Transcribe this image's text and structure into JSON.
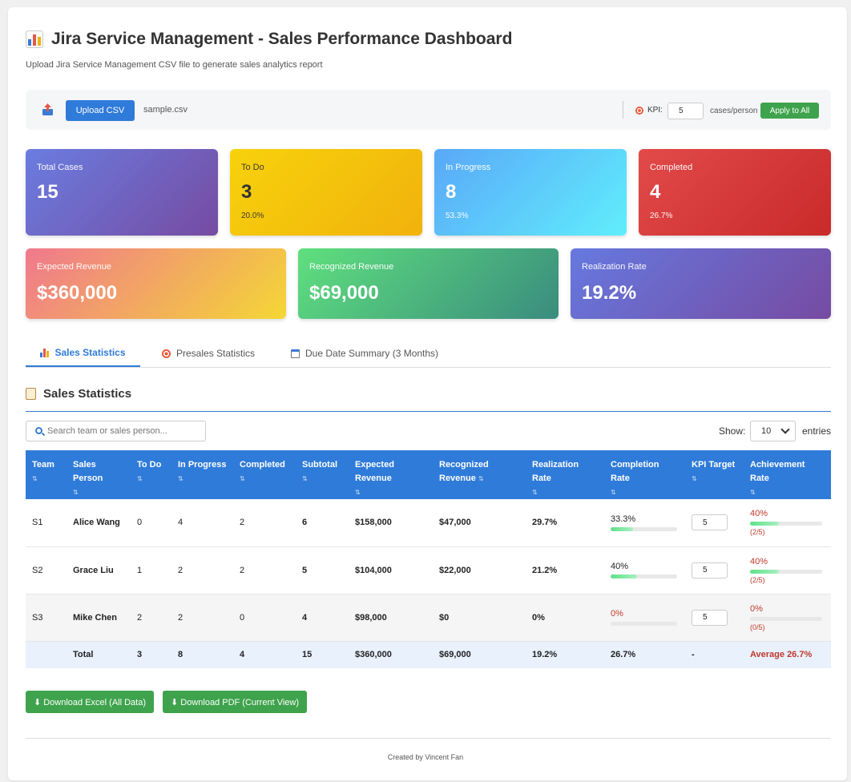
{
  "header": {
    "title": "Jira Service Management - Sales Performance Dashboard",
    "title_icon": "bar-chart-icon",
    "subtitle": "Upload Jira Service Management CSV file to generate sales analytics report"
  },
  "upload": {
    "button_label": "Upload CSV",
    "filename": "sample.csv",
    "kpi_label": "KPI:",
    "kpi_value": "5",
    "kpi_unit": "cases/person",
    "apply_label": "Apply to All"
  },
  "stats": {
    "total": {
      "label": "Total Cases",
      "value": "15"
    },
    "todo": {
      "label": "To Do",
      "value": "3",
      "pct": "20.0%"
    },
    "in_progress": {
      "label": "In Progress",
      "value": "8",
      "pct": "53.3%"
    },
    "completed": {
      "label": "Completed",
      "value": "4",
      "pct": "26.7%"
    },
    "expected_revenue": {
      "label": "Expected Revenue",
      "value": "$360,000"
    },
    "recognized_revenue": {
      "label": "Recognized Revenue",
      "value": "$69,000"
    },
    "realization_rate": {
      "label": "Realization Rate",
      "value": "19.2%"
    }
  },
  "colors": {
    "primary": "#2f7bd9",
    "success": "#3fa34d",
    "danger": "#c0392b"
  },
  "tabs": [
    {
      "label": "Sales Statistics",
      "icon": "bar-chart-icon",
      "active": true
    },
    {
      "label": "Presales Statistics",
      "icon": "target-icon",
      "active": false
    },
    {
      "label": "Due Date Summary (3 Months)",
      "icon": "calendar-icon",
      "active": false
    }
  ],
  "section": {
    "title": "Sales Statistics",
    "search_placeholder": "Search team or sales person...",
    "show_label": "Show:",
    "show_value": "10",
    "entries_label": "entries"
  },
  "table": {
    "sort_glyph": "⇅",
    "headers": [
      "Team",
      "Sales Person",
      "To Do",
      "In Progress",
      "Completed",
      "Subtotal",
      "Expected Revenue",
      "Recognized Revenue",
      "Realization Rate",
      "Completion Rate",
      "KPI Target",
      "Achievement Rate"
    ],
    "rows": [
      {
        "team": "S1",
        "person": "Alice Wang",
        "todo": "0",
        "in_progress": "4",
        "completed": "2",
        "subtotal": "6",
        "expected": "$158,000",
        "recognized": "$47,000",
        "realization": "29.7%",
        "completion": "33.3%",
        "completion_frac": 0.333,
        "kpi": "5",
        "achievement": "40%",
        "achievement_frac": 0.4,
        "achievement_detail": "(2/5)"
      },
      {
        "team": "S2",
        "person": "Grace Liu",
        "todo": "1",
        "in_progress": "2",
        "completed": "2",
        "subtotal": "5",
        "expected": "$104,000",
        "recognized": "$22,000",
        "realization": "21.2%",
        "completion": "40%",
        "completion_frac": 0.4,
        "kpi": "5",
        "achievement": "40%",
        "achievement_frac": 0.4,
        "achievement_detail": "(2/5)"
      },
      {
        "team": "S3",
        "person": "Mike Chen",
        "todo": "2",
        "in_progress": "2",
        "completed": "0",
        "subtotal": "4",
        "expected": "$98,000",
        "recognized": "$0",
        "realization": "0%",
        "completion": "0%",
        "completion_frac": 0,
        "kpi": "5",
        "achievement": "0%",
        "achievement_frac": 0,
        "achievement_detail": "(0/5)"
      }
    ],
    "total": {
      "label": "Total",
      "todo": "3",
      "in_progress": "8",
      "completed": "4",
      "subtotal": "15",
      "expected": "$360,000",
      "recognized": "$69,000",
      "realization": "19.2%",
      "completion": "26.7%",
      "kpi": "-",
      "achievement": "Average 26.7%"
    }
  },
  "actions": {
    "excel_label": "⬇ Download Excel (All Data)",
    "pdf_label": "⬇ Download PDF (Current View)"
  },
  "footer": {
    "text": "Created by Vincent Fan"
  }
}
